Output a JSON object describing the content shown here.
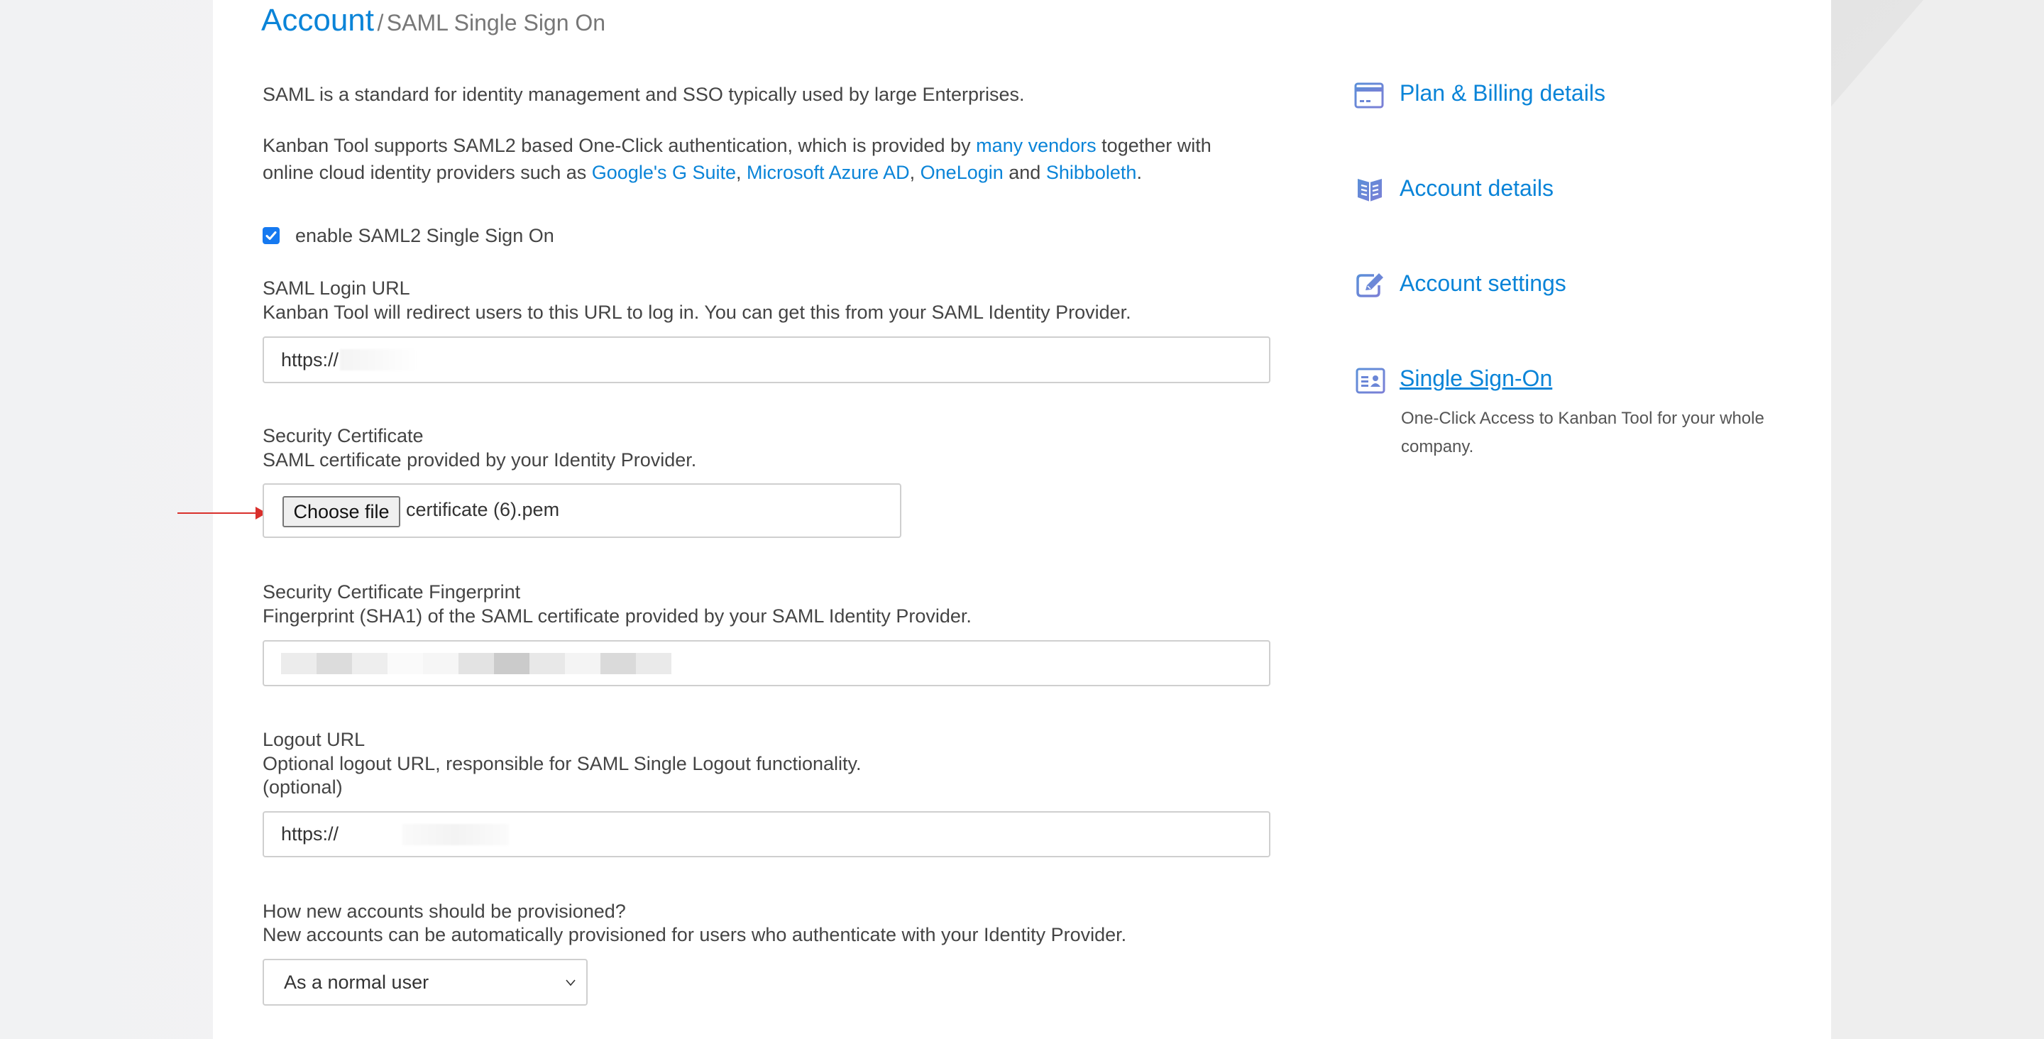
{
  "breadcrumb": {
    "root": "Account",
    "separator": "/",
    "current": "SAML Single Sign On"
  },
  "intro": {
    "p1": "SAML is a standard for identity management and SSO typically used by large Enterprises.",
    "p2_before": "Kanban Tool supports SAML2 based One-Click authentication, which is provided by ",
    "p2_link_vendors": "many vendors",
    "p2_after_vendors": " together with",
    "p2_line2_before": "online cloud identity providers such as ",
    "p2_link_google": "Google's G Suite",
    "p2_comma1": ", ",
    "p2_link_azure": "Microsoft Azure AD",
    "p2_comma2": ", ",
    "p2_link_onelogin": "OneLogin",
    "p2_and": " and ",
    "p2_link_shibboleth": "Shibboleth",
    "p2_end": "."
  },
  "enable_sso": {
    "checked": true,
    "label": "enable SAML2 Single Sign On"
  },
  "login_url": {
    "label": "SAML Login URL",
    "description": "Kanban Tool will redirect users to this URL to log in. You can get this from your SAML Identity Provider.",
    "value": "https://"
  },
  "certificate": {
    "label": "Security Certificate",
    "description": "SAML certificate provided by your Identity Provider.",
    "button_label": "Choose file",
    "file_name": "certificate (6).pem"
  },
  "fingerprint": {
    "label": "Security Certificate Fingerprint",
    "description": "Fingerprint (SHA1) of the SAML certificate provided by your SAML Identity Provider.",
    "value_redacted": true
  },
  "logout_url": {
    "label": "Logout URL",
    "description": "Optional logout URL, responsible for SAML Single Logout functionality.",
    "optional_note": "(optional)",
    "value": "https://"
  },
  "provisioning": {
    "label": "How new accounts should be provisioned?",
    "description": "New accounts can be automatically provisioned for users who authenticate with your Identity Provider.",
    "selected": "As a normal user"
  },
  "sidebar": {
    "items": [
      {
        "label": "Plan & Billing details",
        "icon": "credit-card-icon"
      },
      {
        "label": "Account details",
        "icon": "open-book-icon"
      },
      {
        "label": "Account settings",
        "icon": "edit-pencil-icon"
      },
      {
        "label": "Single Sign-On",
        "icon": "id-card-icon",
        "active": true,
        "description": "One-Click Access to Kanban Tool for your whole company."
      }
    ]
  },
  "colors": {
    "accent": "#0a84d8",
    "checkbox": "#1679f0",
    "annotation_arrow": "#d9302c",
    "text": "#444444"
  }
}
